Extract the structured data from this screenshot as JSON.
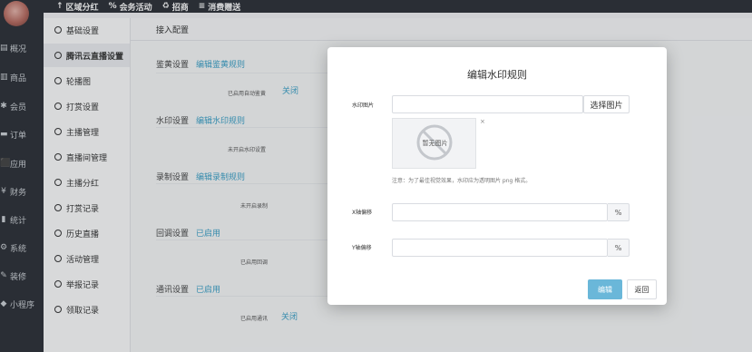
{
  "topbar": {
    "items": [
      {
        "icon": "pin-icon",
        "glyph": "↑",
        "label": "区域分红"
      },
      {
        "icon": "percent-icon",
        "glyph": "%",
        "label": "会务活动"
      },
      {
        "icon": "recycle-icon",
        "glyph": "♻",
        "label": "招商"
      },
      {
        "icon": "list-icon",
        "glyph": "≡",
        "label": "消费赠送"
      }
    ]
  },
  "rail": {
    "items": [
      {
        "glyph": "▤",
        "label": "概况"
      },
      {
        "glyph": "▥",
        "label": "商品"
      },
      {
        "glyph": "✱",
        "label": "会员"
      },
      {
        "glyph": "▬",
        "label": "订单"
      },
      {
        "glyph": "⬛",
        "label": "应用"
      },
      {
        "glyph": "¥",
        "label": "财务"
      },
      {
        "glyph": "▮",
        "label": "统计"
      },
      {
        "glyph": "⚙",
        "label": "系统"
      },
      {
        "glyph": "✎",
        "label": "装修"
      },
      {
        "glyph": "◆",
        "label": "小程序"
      }
    ]
  },
  "sidebar": {
    "items": [
      {
        "label": "基础设置",
        "active": false
      },
      {
        "label": "腾讯云直播设置",
        "active": true
      },
      {
        "label": "轮播图",
        "active": false
      },
      {
        "label": "打赏设置",
        "active": false
      },
      {
        "label": "主播管理",
        "active": false
      },
      {
        "label": "直播间管理",
        "active": false
      },
      {
        "label": "主播分红",
        "active": false
      },
      {
        "label": "打赏记录",
        "active": false
      },
      {
        "label": "历史直播",
        "active": false
      },
      {
        "label": "活动管理",
        "active": false
      },
      {
        "label": "举报记录",
        "active": false
      },
      {
        "label": "领取记录",
        "active": false
      }
    ]
  },
  "main": {
    "tab_label": "接入配置",
    "sections": [
      {
        "label": "鉴黄设置",
        "link": "编辑鉴黄规则",
        "status": "已启用自动鉴黄",
        "close": "关闭"
      },
      {
        "label": "水印设置",
        "link": "编辑水印规则",
        "status": "未开启水印设置",
        "close": ""
      },
      {
        "label": "录制设置",
        "link": "编辑录制规则",
        "status": "未开启录制",
        "close": ""
      },
      {
        "label": "回调设置",
        "link": "已启用",
        "status": "已启用回调",
        "close": ""
      },
      {
        "label": "通讯设置",
        "link": "已启用",
        "status": "已启用通讯",
        "close": "关闭"
      }
    ]
  },
  "modal": {
    "title": "编辑水印规则",
    "watermark_label": "水印图片",
    "watermark_value": "",
    "select_image_button": "选择图片",
    "no_image_text": "暂无图片",
    "remove_glyph": "×",
    "hint": "注意：为了最佳视觉效果，水印应为透明图片 png 格式。",
    "x_offset_label": "X轴偏移",
    "x_offset_value": "",
    "y_offset_label": "Y轴偏移",
    "y_offset_value": "",
    "percent_suffix": "%",
    "edit_button": "编辑",
    "back_button": "返回"
  },
  "colors": {
    "dark_nav": "#2b2f36",
    "link": "#3aa1c8",
    "primary_button": "#6ab7d9"
  }
}
